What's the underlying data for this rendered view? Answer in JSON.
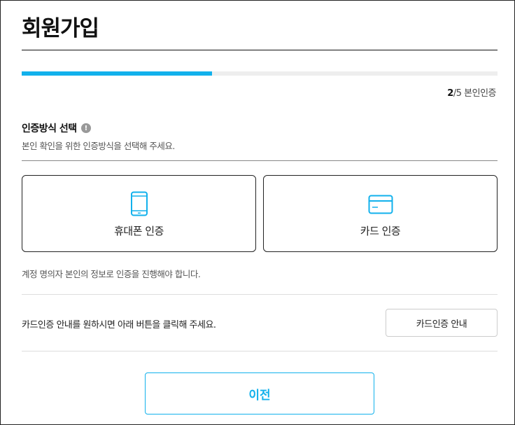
{
  "header": {
    "title": "회원가입"
  },
  "progress": {
    "current_step": "2",
    "total_steps": "5",
    "step_label": "본인인증",
    "fill_fraction": 0.4,
    "accent_color": "#12b1ec"
  },
  "section": {
    "title": "인증방식 선택",
    "info_icon": "info-circle-icon",
    "description": "본인 확인을 위한 인증방식을 선택해 주세요."
  },
  "methods": [
    {
      "label": "휴대폰 인증",
      "icon": "smartphone-icon"
    },
    {
      "label": "카드 인증",
      "icon": "credit-card-icon"
    }
  ],
  "notice": "계정 명의자 본인의 정보로 인증을 진행해야 합니다.",
  "card_guide": {
    "text": "카드인증 안내를 원하시면 아래 버튼을 클릭해 주세요.",
    "button_label": "카드인증 안내"
  },
  "footer": {
    "prev_label": "이전"
  }
}
